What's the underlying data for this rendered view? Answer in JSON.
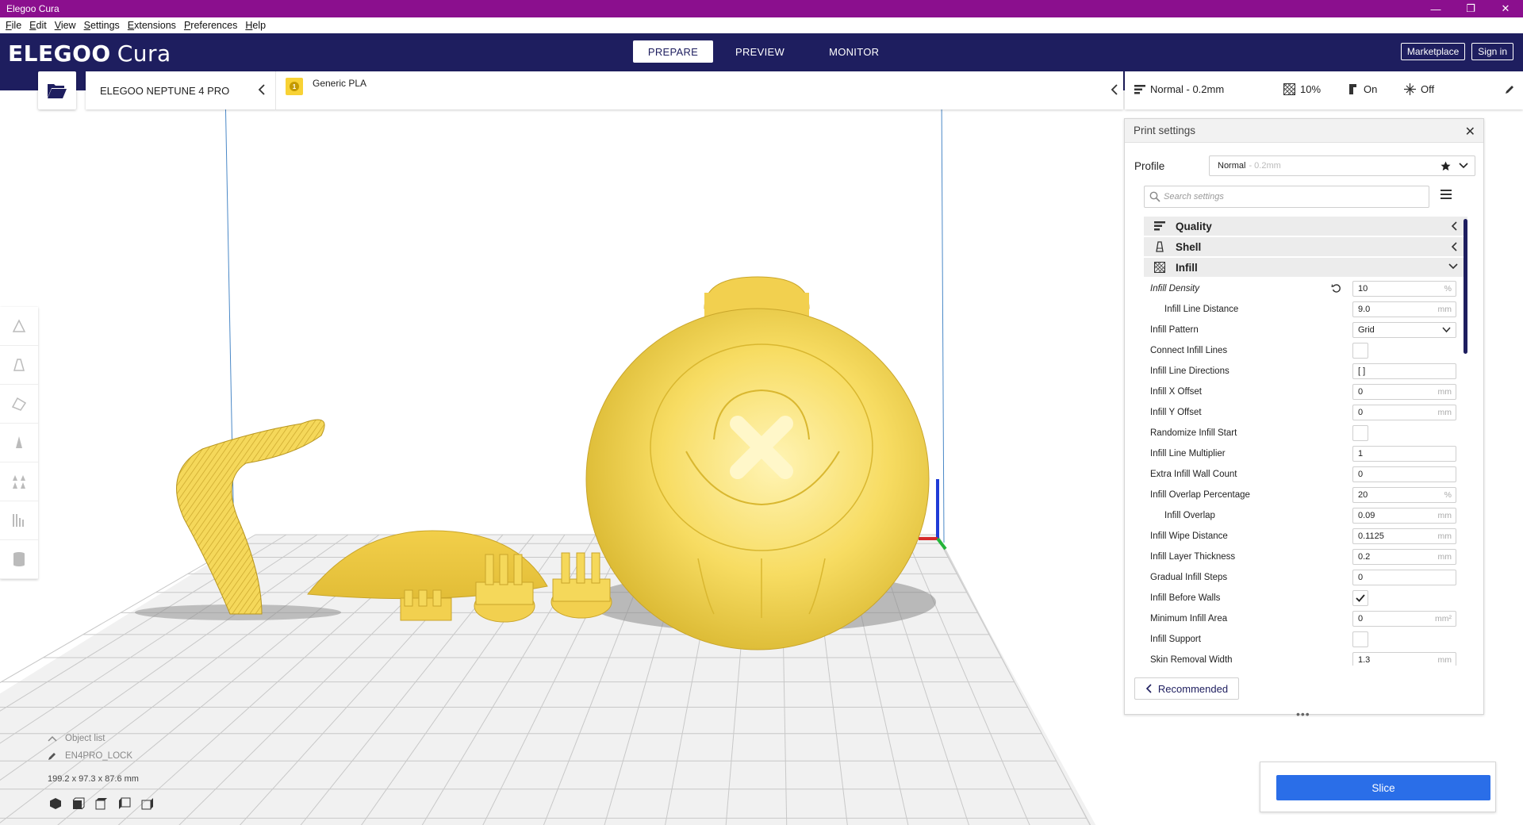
{
  "window": {
    "title": "Elegoo Cura",
    "minimize": "—",
    "maximize": "❐",
    "close": "✕"
  },
  "menu": [
    "File",
    "Edit",
    "View",
    "Settings",
    "Extensions",
    "Preferences",
    "Help"
  ],
  "header": {
    "logo_brand": "ELEGOO",
    "logo_product": "Cura",
    "tabs": [
      "PREPARE",
      "PREVIEW",
      "MONITOR"
    ],
    "active_tab": "PREPARE",
    "marketplace": "Marketplace",
    "signin": "Sign in",
    "bg_color": "#1e1e5f"
  },
  "printer": {
    "name": "ELEGOO NEPTUNE 4 PRO",
    "extruder_number": "1",
    "material": "Generic PLA",
    "material_color": "#f8d235"
  },
  "settings_summary": {
    "profile": "Normal - 0.2mm",
    "infill": "10%",
    "support": "On",
    "adhesion": "Off"
  },
  "panel": {
    "title": "Print settings",
    "profile_label": "Profile",
    "profile_name": "Normal",
    "profile_sub": "- 0.2mm",
    "search_placeholder": "Search settings",
    "categories": [
      {
        "label": "Quality",
        "icon": "quality-icon",
        "expanded": false
      },
      {
        "label": "Shell",
        "icon": "shell-icon",
        "expanded": false
      },
      {
        "label": "Infill",
        "icon": "infill-icon",
        "expanded": true
      }
    ],
    "rows": [
      {
        "label": "Infill Density",
        "type": "value",
        "value": "10",
        "unit": "%",
        "italic": true,
        "reset": true
      },
      {
        "label": "Infill Line Distance",
        "type": "value",
        "value": "9.0",
        "unit": "mm",
        "child": true
      },
      {
        "label": "Infill Pattern",
        "type": "select",
        "value": "Grid"
      },
      {
        "label": "Connect Infill Lines",
        "type": "check",
        "checked": false
      },
      {
        "label": "Infill Line Directions",
        "type": "value",
        "value": "[ ]",
        "unit": ""
      },
      {
        "label": "Infill X Offset",
        "type": "value",
        "value": "0",
        "unit": "mm"
      },
      {
        "label": "Infill Y Offset",
        "type": "value",
        "value": "0",
        "unit": "mm"
      },
      {
        "label": "Randomize Infill Start",
        "type": "check",
        "checked": false
      },
      {
        "label": "Infill Line Multiplier",
        "type": "value",
        "value": "1",
        "unit": ""
      },
      {
        "label": "Extra Infill Wall Count",
        "type": "value",
        "value": "0",
        "unit": ""
      },
      {
        "label": "Infill Overlap Percentage",
        "type": "value",
        "value": "20",
        "unit": "%"
      },
      {
        "label": "Infill Overlap",
        "type": "value",
        "value": "0.09",
        "unit": "mm",
        "child": true
      },
      {
        "label": "Infill Wipe Distance",
        "type": "value",
        "value": "0.1125",
        "unit": "mm"
      },
      {
        "label": "Infill Layer Thickness",
        "type": "value",
        "value": "0.2",
        "unit": "mm"
      },
      {
        "label": "Gradual Infill Steps",
        "type": "value",
        "value": "0",
        "unit": ""
      },
      {
        "label": "Infill Before Walls",
        "type": "check",
        "checked": true
      },
      {
        "label": "Minimum Infill Area",
        "type": "value",
        "value": "0",
        "unit": "mm²"
      },
      {
        "label": "Infill Support",
        "type": "check",
        "checked": false
      },
      {
        "label": "Skin Removal Width",
        "type": "value",
        "value": "1.3",
        "unit": "mm"
      }
    ],
    "recommended": "Recommended",
    "drag_handle": "•••"
  },
  "slice": {
    "label": "Slice",
    "color": "#2a6ee8"
  },
  "objects": {
    "list_label": "Object list",
    "object_name": "EN4PRO_LOCK",
    "dimensions": "199.2 x 97.3 x 87.6 mm"
  },
  "model_color": "#f5d85a"
}
